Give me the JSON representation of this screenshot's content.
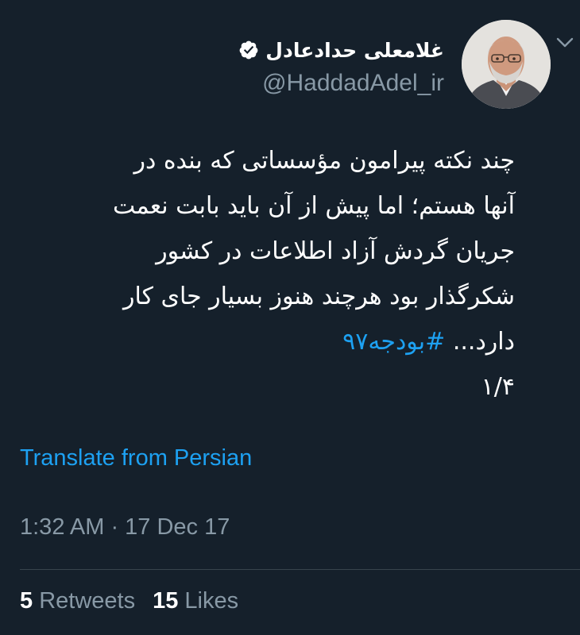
{
  "tweet": {
    "author": {
      "display_name": "غلامعلی حدادعادل",
      "handle": "@HaddadAdel_ir",
      "verified": true
    },
    "text_lines": [
      "چند نکته پیرامون مؤسساتی که بنده در",
      "آنها هستم؛ اما پیش از آن باید بابت نعمت",
      "جریان گردش آزاد اطلاعات در کشور",
      "شکرگذار بود هرچند هنوز بسیار جای کار"
    ],
    "last_line_text": "دارد...",
    "hashtag": "#بودجه۹۷",
    "thread_marker": "۱/۴",
    "translate_label": "Translate from Persian",
    "timestamp": "1:32 AM · 17 Dec 17",
    "retweets_count": "5",
    "retweets_label": "Retweets",
    "likes_count": "15",
    "likes_label": "Likes"
  },
  "icons": {
    "menu": "chevron-down-icon",
    "verified": "verified-badge-icon"
  },
  "colors": {
    "background": "#15202b",
    "accent": "#1da1f2",
    "secondary_text": "#8899a6",
    "divider": "#38444d"
  }
}
